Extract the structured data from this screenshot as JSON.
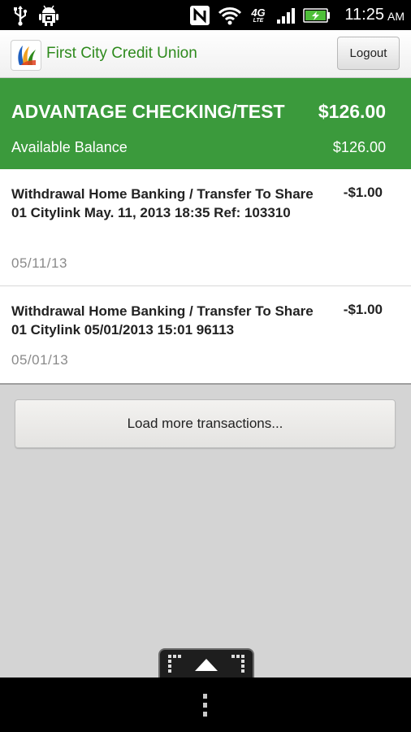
{
  "status_bar": {
    "time": "11:25",
    "ampm": "AM",
    "network_label": "4G",
    "network_sublabel": "LTE",
    "icons": [
      "usb-icon",
      "android-debug-icon",
      "nfc-icon",
      "wifi-icon",
      "4g-lte-icon",
      "signal-icon",
      "battery-charging-icon"
    ]
  },
  "header": {
    "app_title": "First City Credit Union",
    "logout_label": "Logout",
    "brand_color": "#2e8a1d"
  },
  "account": {
    "name": "ADVANTAGE CHECKING/TEST",
    "balance": "$126.00",
    "available_label": "Available Balance",
    "available_value": "$126.00",
    "banner_color": "#3b9a3c"
  },
  "transactions": [
    {
      "description": "Withdrawal Home Banking / Transfer To Share 01 Citylink May. 11, 2013 18:35 Ref: 103310",
      "amount": "-$1.00",
      "date": "05/11/13"
    },
    {
      "description": "Withdrawal Home Banking / Transfer To Share 01 Citylink 05/01/2013 15:01 96113",
      "amount": "-$1.00",
      "date": "05/01/13"
    }
  ],
  "load_more_label": "Load more transactions...",
  "nav": {
    "icons": [
      "expand-up-icon",
      "overflow-menu-icon"
    ]
  }
}
